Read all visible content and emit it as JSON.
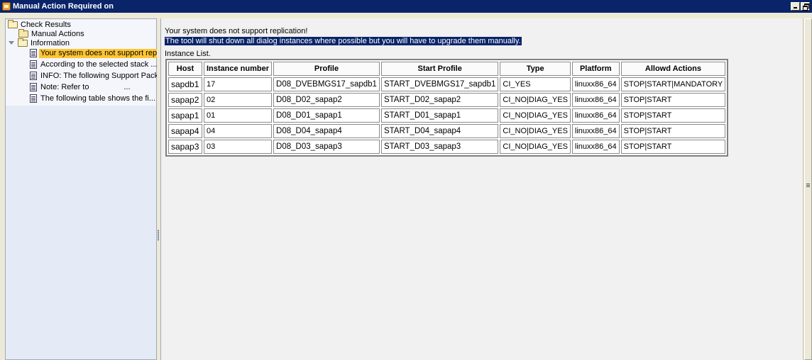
{
  "window": {
    "title": "Manual Action Required on",
    "icon": "app-icon",
    "controls": [
      "minimize-icon",
      "restore-icon"
    ]
  },
  "tree": {
    "root": {
      "label": "Check Results",
      "icon": "folder-open-icon"
    },
    "manual_actions": {
      "label": "Manual Actions",
      "icon": "folder-icon"
    },
    "information": {
      "label": "Information",
      "icon": "folder-open-icon",
      "expanded": true,
      "items": [
        {
          "label": "Your system does not support rep...",
          "selected": true,
          "icon": "document-icon"
        },
        {
          "label": "According to the selected stack ...",
          "icon": "document-icon"
        },
        {
          "label": "INFO: The following Support Pack...",
          "icon": "document-icon"
        },
        {
          "label": "Note: Refer to                ...",
          "icon": "document-icon"
        },
        {
          "label": "The following table shows the fi...",
          "icon": "document-icon"
        }
      ]
    }
  },
  "content": {
    "message1": "Your system does not support replication!",
    "message2": "The tool will shut down all dialog instances where possible but you will have to upgrade them manually.",
    "instance_list_label": "Instance List.",
    "table": {
      "headers": [
        "Host",
        "Instance number",
        "Profile",
        "Start Profile",
        "Type",
        "Platform",
        "Allowd Actions"
      ],
      "rows": [
        [
          "sapdb1",
          "17",
          "D08_DVEBMGS17_sapdb1",
          "START_DVEBMGS17_sapdb1",
          "CI_YES",
          "linuxx86_64",
          "STOP|START|MANDATORY"
        ],
        [
          "sapap2",
          "02",
          "D08_D02_sapap2",
          "START_D02_sapap2",
          "CI_NO|DIAG_YES",
          "linuxx86_64",
          "STOP|START"
        ],
        [
          "sapap1",
          "01",
          "D08_D01_sapap1",
          "START_D01_sapap1",
          "CI_NO|DIAG_YES",
          "linuxx86_64",
          "STOP|START"
        ],
        [
          "sapap4",
          "04",
          "D08_D04_sapap4",
          "START_D04_sapap4",
          "CI_NO|DIAG_YES",
          "linuxx86_64",
          "STOP|START"
        ],
        [
          "sapap3",
          "03",
          "D08_D03_sapap3",
          "START_D03_sapap3",
          "CI_NO|DIAG_YES",
          "linuxx86_64",
          "STOP|START"
        ]
      ]
    }
  },
  "colors": {
    "titlebar": "#0a246a",
    "selection": "#ffc632",
    "highlight": "#0a246a",
    "tree_background": "#e5ebf6"
  }
}
